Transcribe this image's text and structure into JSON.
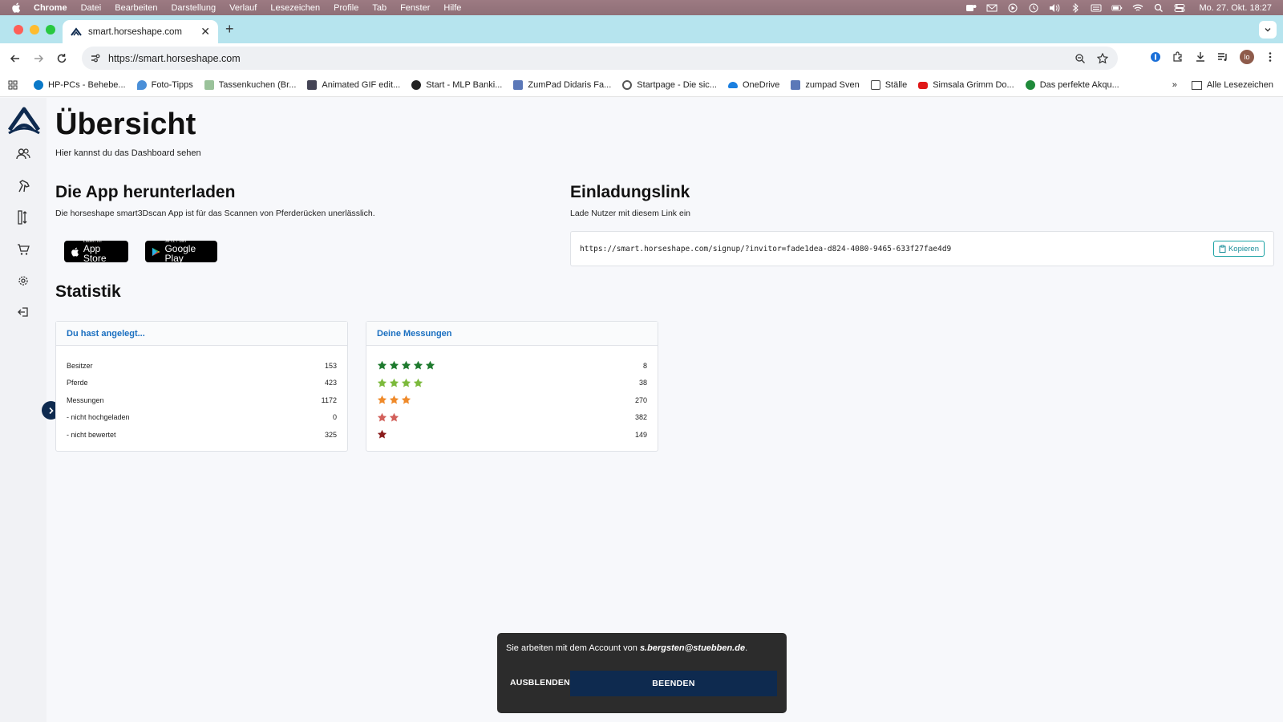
{
  "menubar": {
    "items": [
      "Chrome",
      "Datei",
      "Bearbeiten",
      "Darstellung",
      "Verlauf",
      "Lesezeichen",
      "Profile",
      "Tab",
      "Fenster",
      "Hilfe"
    ],
    "clock": "Mo. 27. Okt. 18:27"
  },
  "browser": {
    "tab_title": "smart.horseshape.com",
    "url": "https://smart.horseshape.com",
    "avatar": "lo",
    "bookmarks": [
      "HP-PCs - Behebe...",
      "Foto-Tipps",
      "Tassenkuchen (Br...",
      "Animated GIF edit...",
      "Start - MLP Banki...",
      "ZumPad Didaris Fa...",
      "Startpage - Die sic...",
      "OneDrive",
      "zumpad Sven",
      "Ställe",
      "Simsala Grimm Do...",
      "Das perfekte Akqu..."
    ],
    "all_bookmarks": "Alle Lesezeichen",
    "more": "»"
  },
  "page": {
    "title": "Übersicht",
    "subtitle": "Hier kannst du das Dashboard sehen",
    "app": {
      "heading": "Die App herunterladen",
      "text": "Die horseshape smart3Dscan App ist für das Scannen von Pferderücken unerlässlich.",
      "appstore_small": "Laden im",
      "appstore_big": "App Store",
      "gplay_small": "JETZT BEI",
      "gplay_big": "Google Play"
    },
    "invite": {
      "heading": "Einladungslink",
      "text": "Lade Nutzer mit diesem Link ein",
      "url": "https://smart.horseshape.com/signup/?invitor=fade1dea-d824-4080-9465-633f27fae4d9",
      "copy_label": "Kopieren"
    },
    "stats": {
      "heading": "Statistik",
      "created": {
        "title": "Du hast angelegt...",
        "rows": [
          {
            "label": "Besitzer",
            "value": "153"
          },
          {
            "label": "Pferde",
            "value": "423"
          },
          {
            "label": "Messungen",
            "value": "1172"
          },
          {
            "label": "- nicht hochgeladen",
            "value": "0"
          },
          {
            "label": "- nicht bewertet",
            "value": "325"
          }
        ]
      },
      "measurements": {
        "title": "Deine Messungen",
        "rows": [
          {
            "stars": 5,
            "color": "#1e7a2e",
            "value": "8"
          },
          {
            "stars": 4,
            "color": "#7cba3c",
            "value": "38"
          },
          {
            "stars": 3,
            "color": "#ef8a2a",
            "value": "270"
          },
          {
            "stars": 2,
            "color": "#d2605b",
            "value": "382"
          },
          {
            "stars": 1,
            "color": "#8a1c1c",
            "value": "149"
          }
        ]
      }
    }
  },
  "toast": {
    "message_prefix": "Sie arbeiten mit dem Account von ",
    "account": "s.bergsten@stuebben.de",
    "message_suffix": ".",
    "hide_label": "AUSBLENDEN",
    "end_label": "BEENDEN"
  }
}
